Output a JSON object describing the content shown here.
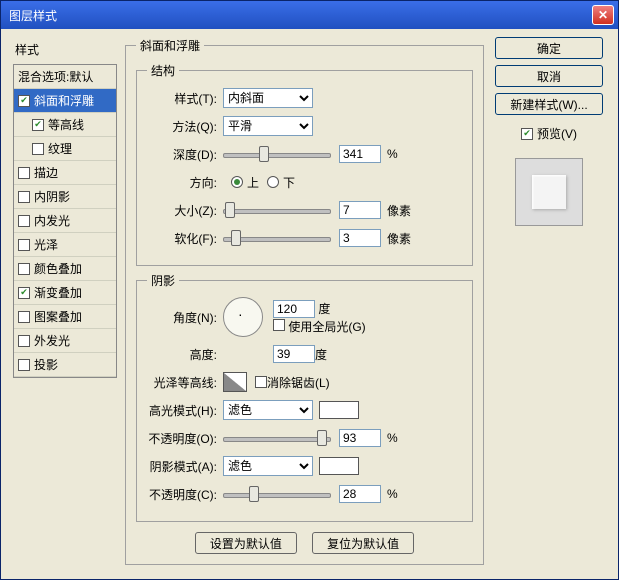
{
  "title": "图层样式",
  "sidebar": {
    "header": "样式",
    "blending": "混合选项:默认",
    "items": [
      {
        "label": "斜面和浮雕",
        "checked": true,
        "selected": true
      },
      {
        "label": "等高线",
        "checked": true,
        "sub": true
      },
      {
        "label": "纹理",
        "checked": false,
        "sub": true
      },
      {
        "label": "描边",
        "checked": false
      },
      {
        "label": "内阴影",
        "checked": false
      },
      {
        "label": "内发光",
        "checked": false
      },
      {
        "label": "光泽",
        "checked": false
      },
      {
        "label": "颜色叠加",
        "checked": false
      },
      {
        "label": "渐变叠加",
        "checked": true
      },
      {
        "label": "图案叠加",
        "checked": false
      },
      {
        "label": "外发光",
        "checked": false
      },
      {
        "label": "投影",
        "checked": false
      }
    ]
  },
  "panel_title": "斜面和浮雕",
  "structure": {
    "legend": "结构",
    "style_label": "样式(T):",
    "style_value": "内斜面",
    "method_label": "方法(Q):",
    "method_value": "平滑",
    "depth_label": "深度(D):",
    "depth_value": "341",
    "depth_unit": "%",
    "direction_label": "方向:",
    "up": "上",
    "down": "下",
    "size_label": "大小(Z):",
    "size_value": "7",
    "size_unit": "像素",
    "soften_label": "软化(F):",
    "soften_value": "3",
    "soften_unit": "像素"
  },
  "shadow": {
    "legend": "阴影",
    "angle_label": "角度(N):",
    "angle_value": "120",
    "angle_unit": "度",
    "global_label": "使用全局光(G)",
    "altitude_label": "高度:",
    "altitude_value": "39",
    "altitude_unit": "度",
    "gloss_label": "光泽等高线:",
    "antialias_label": "消除锯齿(L)",
    "hmode_label": "高光模式(H):",
    "hmode_value": "滤色",
    "hopacity_label": "不透明度(O):",
    "hopacity_value": "93",
    "hopacity_unit": "%",
    "smode_label": "阴影模式(A):",
    "smode_value": "滤色",
    "sopacity_label": "不透明度(C):",
    "sopacity_value": "28",
    "sopacity_unit": "%"
  },
  "buttons": {
    "default": "设置为默认值",
    "reset": "复位为默认值",
    "ok": "确定",
    "cancel": "取消",
    "newstyle": "新建样式(W)...",
    "preview": "预览(V)"
  }
}
